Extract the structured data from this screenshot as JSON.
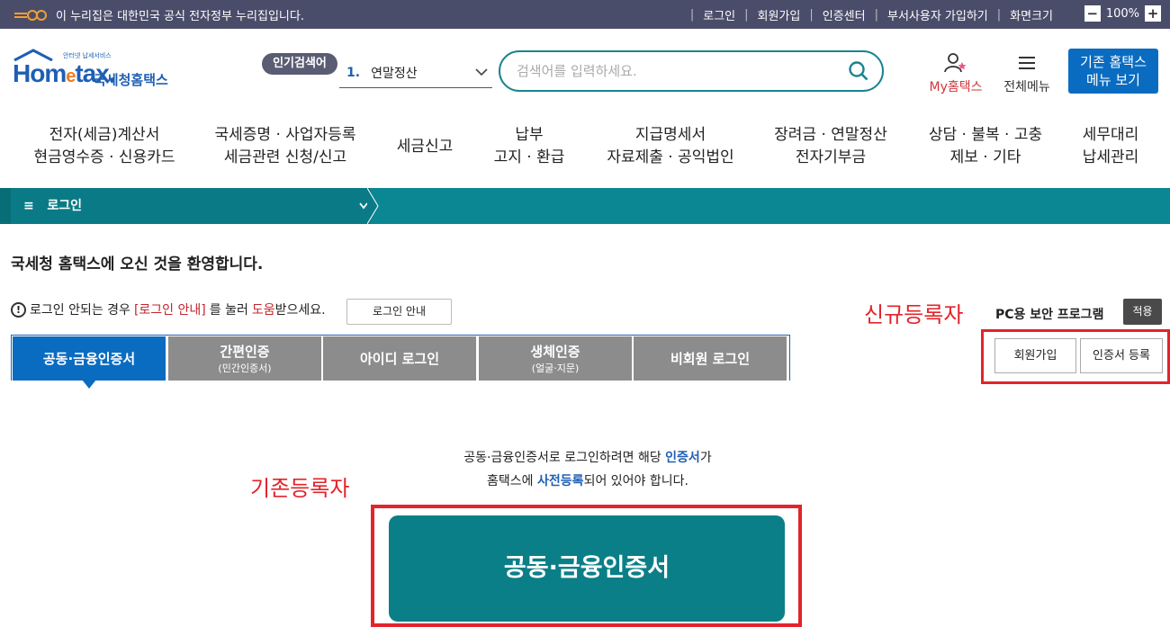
{
  "topbar": {
    "gov_notice": "이 누리집은 대한민국 공식 전자정부 누리집입니다.",
    "links": [
      "로그인",
      "회원가입",
      "인증센터",
      "부서사용자 가입하기",
      "화면크기"
    ],
    "zoom_minus": "−",
    "zoom_value": "100%",
    "zoom_plus": "+"
  },
  "header": {
    "logo_tiny": "안터넷 납세서비스",
    "logo_home": "Hom",
    "logo_e": "e",
    "logo_tax": "tax.",
    "logo_sub": "국세청홈택스",
    "popular_badge": "인기검색어",
    "popular_rank": "1.",
    "popular_term": "연말정산",
    "search_placeholder": "검색어를 입력하세요.",
    "my_hometax": "My홈택스",
    "all_menu": "전체메뉴",
    "old_hometax_line1": "기존 홈택스",
    "old_hometax_line2": "메뉴 보기"
  },
  "gnb": [
    {
      "line1": "전자(세금)계산서",
      "line2": "현금영수증 · 신용카드"
    },
    {
      "line1": "국세증명 · 사업자등록",
      "line2": "세금관련 신청/신고"
    },
    {
      "line1": "세금신고",
      "line2": ""
    },
    {
      "line1": "납부",
      "line2": "고지 · 환급"
    },
    {
      "line1": "지급명세서",
      "line2": "자료제출 · 공익법인"
    },
    {
      "line1": "장려금 · 연말정산",
      "line2": "전자기부금"
    },
    {
      "line1": "상담 · 불복 · 고충",
      "line2": "제보 · 기타"
    },
    {
      "line1": "세무대리",
      "line2": "납세관리"
    }
  ],
  "breadcrumb": {
    "label": "로그인"
  },
  "main": {
    "welcome": "국세청 홈택스에 오신 것을 환영합니다.",
    "notice_pre": "로그인 안되는 경우",
    "notice_link": "[로그인 안내]",
    "notice_mid": "를 눌러",
    "notice_help": "도움",
    "notice_post": "받으세요.",
    "guide_button": "로그인 안내",
    "annotation_new": "신규등록자",
    "security_program": "PC용 보안 프로그램",
    "apply_button": "적용",
    "join_button": "회원가입",
    "cert_register_button": "인증서 등록",
    "tabs": [
      {
        "label": "공동·금융인증서",
        "sub": ""
      },
      {
        "label": "간편인증",
        "sub": "(민간인증서)"
      },
      {
        "label": "아이디 로그인",
        "sub": ""
      },
      {
        "label": "생체인증",
        "sub": "(얼굴·지문)"
      },
      {
        "label": "비회원 로그인",
        "sub": ""
      }
    ],
    "desc_line1_pre": "공동·금융인증서로 로그인하려면 해당",
    "desc_line1_em": "인증서",
    "desc_line1_post": "가",
    "desc_line2_pre": "홈택스에",
    "desc_line2_em": "사전등록",
    "desc_line2_post": "되어 있어야 합니다.",
    "annotation_old": "기존등록자",
    "big_cert_button": "공동·금융인증서"
  },
  "colors": {
    "topbar": "#4a4d6a",
    "teal": "#0b8793",
    "blue": "#0a6cc1",
    "annotation_red": "#e2242b"
  }
}
